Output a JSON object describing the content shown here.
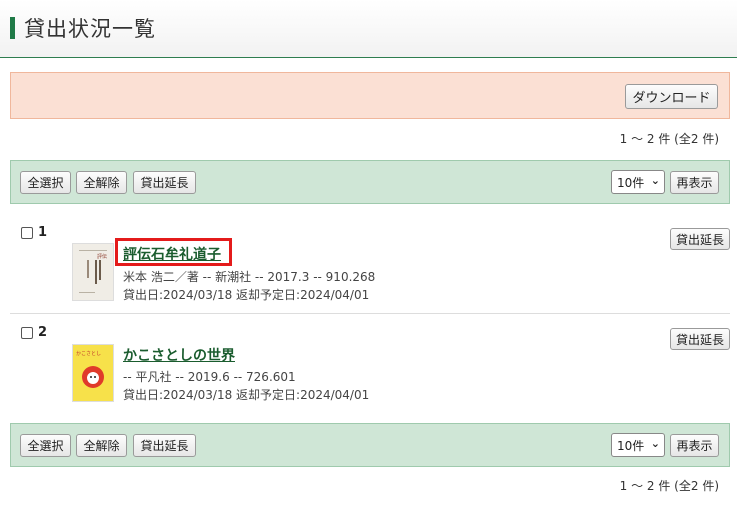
{
  "header": {
    "title": "貸出状況一覧"
  },
  "download": {
    "label": "ダウンロード"
  },
  "count_text": "1 ～ 2 件 (全2 件)",
  "toolbar": {
    "select_all": "全選択",
    "deselect_all": "全解除",
    "extend": "貸出延長",
    "per_page": "10件",
    "redisplay": "再表示"
  },
  "items": [
    {
      "number": "1",
      "title": "評伝石牟礼道子",
      "meta1": "米本 浩二／著 -- 新潮社 -- 2017.3 -- 910.268",
      "meta2": "貸出日:2024/03/18  返却予定日:2024/04/01",
      "extend": "貸出延長"
    },
    {
      "number": "2",
      "title": "かこさとしの世界",
      "meta1": "-- 平凡社 -- 2019.6 -- 726.601",
      "meta2": "貸出日:2024/03/18  返却予定日:2024/04/01",
      "extend": "貸出延長"
    }
  ],
  "colors": {
    "accent_green": "#1f7a47",
    "toolbar_bg": "#cfe6d6",
    "download_bg": "#fbe0d4",
    "highlight": "#e41b1b"
  }
}
